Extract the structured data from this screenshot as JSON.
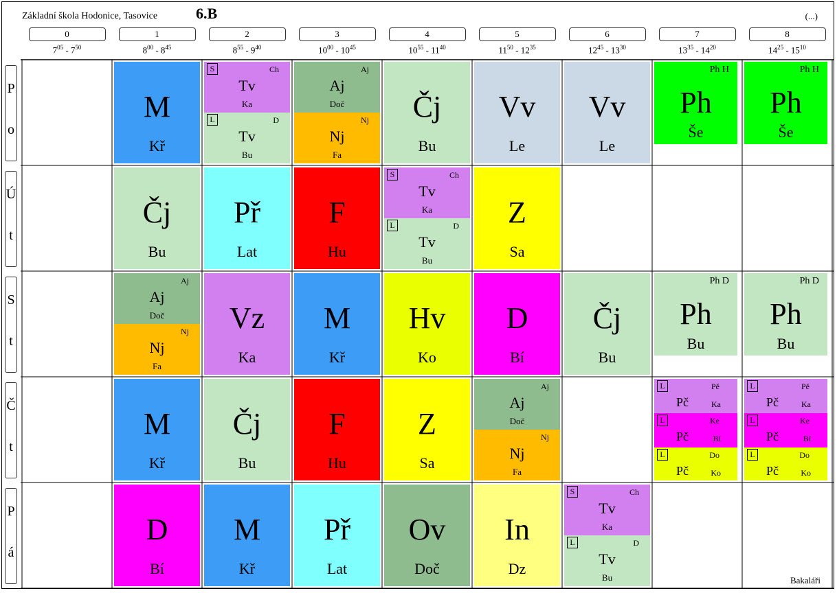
{
  "header": {
    "school": "Základní škola Hodonice, Tasovice",
    "class": "6.B",
    "more": "(...)"
  },
  "periods": [
    {
      "num": "0",
      "from_h": "7",
      "from_m": "05",
      "to_h": "7",
      "to_m": "50"
    },
    {
      "num": "1",
      "from_h": "8",
      "from_m": "00",
      "to_h": "8",
      "to_m": "45"
    },
    {
      "num": "2",
      "from_h": "8",
      "from_m": "55",
      "to_h": "9",
      "to_m": "40"
    },
    {
      "num": "3",
      "from_h": "10",
      "from_m": "00",
      "to_h": "10",
      "to_m": "45"
    },
    {
      "num": "4",
      "from_h": "10",
      "from_m": "55",
      "to_h": "11",
      "to_m": "40"
    },
    {
      "num": "5",
      "from_h": "11",
      "from_m": "50",
      "to_h": "12",
      "to_m": "35"
    },
    {
      "num": "6",
      "from_h": "12",
      "from_m": "45",
      "to_h": "13",
      "to_m": "30"
    },
    {
      "num": "7",
      "from_h": "13",
      "from_m": "35",
      "to_h": "14",
      "to_m": "20"
    },
    {
      "num": "8",
      "from_h": "14",
      "from_m": "25",
      "to_h": "15",
      "to_m": "10"
    }
  ],
  "days": [
    {
      "l1": "P",
      "l2": "o"
    },
    {
      "l1": "Ú",
      "l2": "t"
    },
    {
      "l1": "S",
      "l2": "t"
    },
    {
      "l1": "Č",
      "l2": "t"
    },
    {
      "l1": "P",
      "l2": "á"
    }
  ],
  "lessons": [
    {
      "d": 0,
      "p": 1,
      "kind": "single",
      "subj": "M",
      "teach": "Kř",
      "color": "#3d9cf5"
    },
    {
      "d": 0,
      "p": 2,
      "kind": "split",
      "parts": [
        {
          "box": "S",
          "tag": "Ch",
          "subj": "Tv",
          "teach": "Ka",
          "color": "#d27ff0"
        },
        {
          "box": "L",
          "tag": "D",
          "subj": "Tv",
          "teach": "Bu",
          "color": "#c2e6c2"
        }
      ]
    },
    {
      "d": 0,
      "p": 3,
      "kind": "split",
      "parts": [
        {
          "box": "",
          "tag": "Aj",
          "subj": "Aj",
          "teach": "Doč",
          "color": "#8fbc8f"
        },
        {
          "box": "",
          "tag": "Nj",
          "subj": "Nj",
          "teach": "Fa",
          "color": "#ffbb00"
        }
      ]
    },
    {
      "d": 0,
      "p": 4,
      "kind": "single",
      "subj": "Čj",
      "teach": "Bu",
      "color": "#c2e6c2"
    },
    {
      "d": 0,
      "p": 5,
      "kind": "single",
      "subj": "Vv",
      "teach": "Le",
      "color": "#cad9e5"
    },
    {
      "d": 0,
      "p": 6,
      "kind": "single",
      "subj": "Vv",
      "teach": "Le",
      "color": "#cad9e5"
    },
    {
      "d": 0,
      "p": 7,
      "kind": "ph",
      "grp": "Ph H",
      "subj": "Ph",
      "teach": "Še",
      "color": "#00ff00"
    },
    {
      "d": 0,
      "p": 8,
      "kind": "ph",
      "grp": "Ph H",
      "subj": "Ph",
      "teach": "Še",
      "color": "#00ff00"
    },
    {
      "d": 1,
      "p": 1,
      "kind": "single",
      "subj": "Čj",
      "teach": "Bu",
      "color": "#c2e6c2"
    },
    {
      "d": 1,
      "p": 2,
      "kind": "single",
      "subj": "Př",
      "teach": "Lat",
      "color": "#80ffff"
    },
    {
      "d": 1,
      "p": 3,
      "kind": "single",
      "subj": "F",
      "teach": "Hu",
      "color": "#ff0000"
    },
    {
      "d": 1,
      "p": 4,
      "kind": "split",
      "parts": [
        {
          "box": "S",
          "tag": "Ch",
          "subj": "Tv",
          "teach": "Ka",
          "color": "#d27ff0"
        },
        {
          "box": "L",
          "tag": "D",
          "subj": "Tv",
          "teach": "Bu",
          "color": "#c2e6c2"
        }
      ]
    },
    {
      "d": 1,
      "p": 5,
      "kind": "single",
      "subj": "Z",
      "teach": "Sa",
      "color": "#ffff00"
    },
    {
      "d": 2,
      "p": 1,
      "kind": "split",
      "parts": [
        {
          "box": "",
          "tag": "Aj",
          "subj": "Aj",
          "teach": "Doč",
          "color": "#8fbc8f"
        },
        {
          "box": "",
          "tag": "Nj",
          "subj": "Nj",
          "teach": "Fa",
          "color": "#ffbb00"
        }
      ]
    },
    {
      "d": 2,
      "p": 2,
      "kind": "single",
      "subj": "Vz",
      "teach": "Ka",
      "color": "#d27ff0"
    },
    {
      "d": 2,
      "p": 3,
      "kind": "single",
      "subj": "M",
      "teach": "Kř",
      "color": "#3d9cf5"
    },
    {
      "d": 2,
      "p": 4,
      "kind": "single",
      "subj": "Hv",
      "teach": "Ko",
      "color": "#eaff00"
    },
    {
      "d": 2,
      "p": 5,
      "kind": "single",
      "subj": "D",
      "teach": "Bí",
      "color": "#ff00ff"
    },
    {
      "d": 2,
      "p": 6,
      "kind": "single",
      "subj": "Čj",
      "teach": "Bu",
      "color": "#c2e6c2"
    },
    {
      "d": 2,
      "p": 7,
      "kind": "ph",
      "grp": "Ph D",
      "subj": "Ph",
      "teach": "Bu",
      "color": "#c2e6c2"
    },
    {
      "d": 2,
      "p": 8,
      "kind": "ph",
      "grp": "Ph D",
      "subj": "Ph",
      "teach": "Bu",
      "color": "#c2e6c2"
    },
    {
      "d": 3,
      "p": 1,
      "kind": "single",
      "subj": "M",
      "teach": "Kř",
      "color": "#3d9cf5"
    },
    {
      "d": 3,
      "p": 2,
      "kind": "single",
      "subj": "Čj",
      "teach": "Bu",
      "color": "#c2e6c2"
    },
    {
      "d": 3,
      "p": 3,
      "kind": "single",
      "subj": "F",
      "teach": "Hu",
      "color": "#ff0000"
    },
    {
      "d": 3,
      "p": 4,
      "kind": "single",
      "subj": "Z",
      "teach": "Sa",
      "color": "#ffff00"
    },
    {
      "d": 3,
      "p": 5,
      "kind": "split",
      "parts": [
        {
          "box": "",
          "tag": "Aj",
          "subj": "Aj",
          "teach": "Doč",
          "color": "#8fbc8f"
        },
        {
          "box": "",
          "tag": "Nj",
          "subj": "Nj",
          "teach": "Fa",
          "color": "#ffbb00"
        }
      ]
    },
    {
      "d": 3,
      "p": 7,
      "kind": "third",
      "parts": [
        {
          "box": "L",
          "tag": "Pě",
          "subj": "Pč",
          "teach": "Ka",
          "color": "#d27ff0"
        },
        {
          "box": "L",
          "tag": "Ke",
          "subj": "Pč",
          "teach": "Bí",
          "color": "#ff00ff"
        },
        {
          "box": "L",
          "tag": "Do",
          "subj": "Pč",
          "teach": "Ko",
          "color": "#eaff00"
        }
      ]
    },
    {
      "d": 3,
      "p": 8,
      "kind": "third",
      "parts": [
        {
          "box": "L",
          "tag": "Pě",
          "subj": "Pč",
          "teach": "Ka",
          "color": "#d27ff0"
        },
        {
          "box": "L",
          "tag": "Ke",
          "subj": "Pč",
          "teach": "Bí",
          "color": "#ff00ff"
        },
        {
          "box": "L",
          "tag": "Do",
          "subj": "Pč",
          "teach": "Ko",
          "color": "#eaff00"
        }
      ]
    },
    {
      "d": 4,
      "p": 1,
      "kind": "single",
      "subj": "D",
      "teach": "Bí",
      "color": "#ff00ff"
    },
    {
      "d": 4,
      "p": 2,
      "kind": "single",
      "subj": "M",
      "teach": "Kř",
      "color": "#3d9cf5"
    },
    {
      "d": 4,
      "p": 3,
      "kind": "single",
      "subj": "Př",
      "teach": "Lat",
      "color": "#80ffff"
    },
    {
      "d": 4,
      "p": 4,
      "kind": "single",
      "subj": "Ov",
      "teach": "Doč",
      "color": "#8fbc8f"
    },
    {
      "d": 4,
      "p": 5,
      "kind": "single",
      "subj": "In",
      "teach": "Dz",
      "color": "#ffff80"
    },
    {
      "d": 4,
      "p": 6,
      "kind": "split",
      "parts": [
        {
          "box": "S",
          "tag": "Ch",
          "subj": "Tv",
          "teach": "Ka",
          "color": "#d27ff0"
        },
        {
          "box": "L",
          "tag": "D",
          "subj": "Tv",
          "teach": "Bu",
          "color": "#c2e6c2"
        }
      ]
    }
  ],
  "footer": "Bakaláři"
}
